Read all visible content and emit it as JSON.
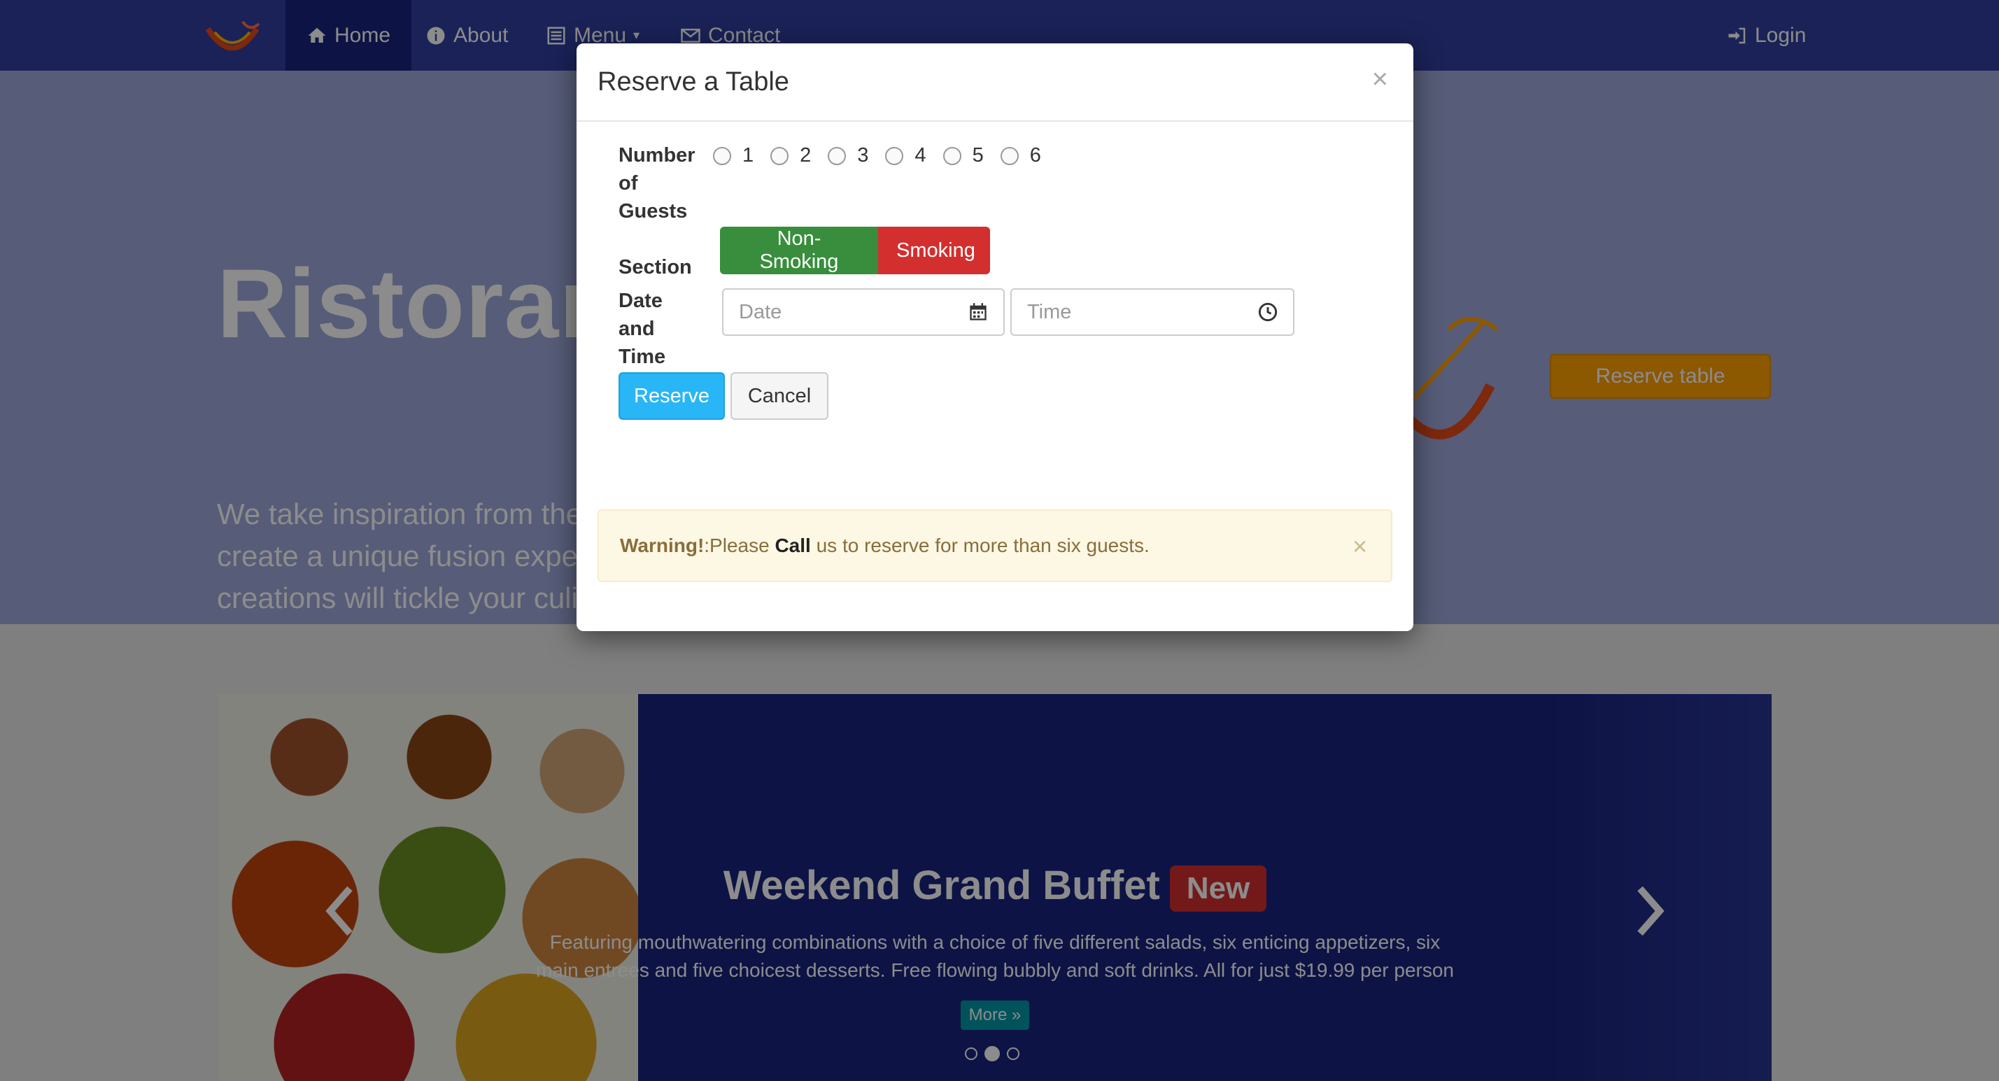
{
  "navbar": {
    "items": [
      {
        "label": "Home",
        "icon": "home-icon"
      },
      {
        "label": "About",
        "icon": "info-icon"
      },
      {
        "label": "Menu",
        "icon": "list-icon"
      },
      {
        "label": "Contact",
        "icon": "envelope-icon"
      }
    ],
    "login_label": "Login",
    "login_icon": "login-icon"
  },
  "hero": {
    "title": "Ristorante con Fusion",
    "text": "We take inspiration from the World's best cuisines, and create a unique fusion experience. Our lipsmacking creations will tickle your culinary senses!",
    "reserve_label": "Reserve table"
  },
  "carousel": {
    "heading": "Weekend Grand Buffet",
    "badge": "New",
    "description": "Featuring mouthwatering combinations with a choice of five different salads, six enticing appetizers, six main entrees and five choicest desserts. Free flowing bubbly and soft drinks. All for just $19.99 per person",
    "more_label": "More »",
    "slides": 3,
    "active_slide": 2
  },
  "modal": {
    "title": "Reserve a Table",
    "close": "×",
    "guests_label": "Number of Guests",
    "guest_options": [
      "1",
      "2",
      "3",
      "4",
      "5",
      "6"
    ],
    "section_label": "Section",
    "section_options": {
      "non_smoking": "Non-Smoking",
      "smoking": "Smoking"
    },
    "datetime_label": "Date and Time",
    "date_placeholder": "Date",
    "time_placeholder": "Time",
    "reserve_label": "Reserve",
    "cancel_label": "Cancel",
    "alert": {
      "strong": "Warning!",
      "text1": ":Please ",
      "call": "Call",
      "text2": " us to reserve for more than six guests.",
      "close": "×"
    }
  },
  "colors": {
    "navbar": "#303f9f",
    "jumbotron": "#9fa8da",
    "reserve_hero": "#ffa000",
    "non_smoking": "#388e3c",
    "smoking": "#d32f2f",
    "reserve_btn": "#29b6f6"
  }
}
